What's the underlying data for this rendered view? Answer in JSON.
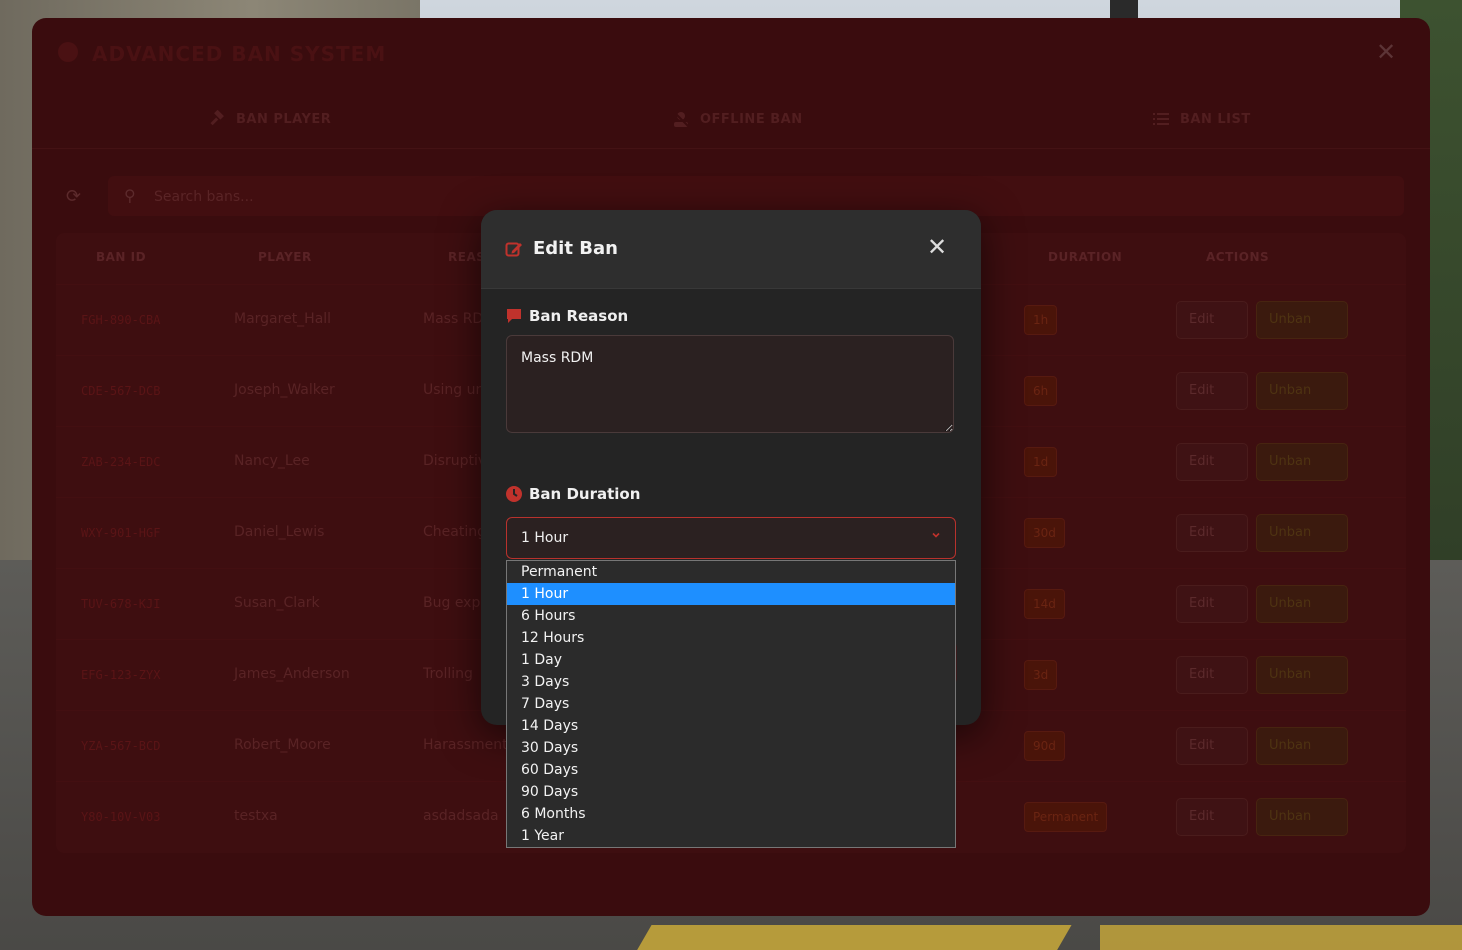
{
  "panel": {
    "title": "ADVANCED BAN SYSTEM",
    "tabs": [
      "BAN PLAYER",
      "OFFLINE BAN",
      "BAN LIST"
    ],
    "search_placeholder": "Search bans...",
    "columns": [
      "BAN ID",
      "PLAYER",
      "REASON",
      "DURATION",
      "ACTIONS"
    ],
    "rows": [
      {
        "id": "FGH-890-CBA",
        "player": "Margaret_Hall",
        "reason": "Mass RDM",
        "duration": "1h"
      },
      {
        "id": "CDE-567-DCB",
        "player": "Joseph_Walker",
        "reason": "Using unauthorized",
        "duration": "6h"
      },
      {
        "id": "ZAB-234-EDC",
        "player": "Nancy_Lee",
        "reason": "Disruptive",
        "duration": "1d"
      },
      {
        "id": "WXY-901-HGF",
        "player": "Daniel_Lewis",
        "reason": "Cheating",
        "duration": "30d"
      },
      {
        "id": "TUV-678-KJI",
        "player": "Susan_Clark",
        "reason": "Bug exploit",
        "duration": "14d"
      },
      {
        "id": "EFG-123-ZYX",
        "player": "James_Anderson",
        "reason": "Trolling",
        "duration": "3d"
      },
      {
        "id": "YZA-567-BCD",
        "player": "Robert_Moore",
        "reason": "Harassment",
        "duration": "90d"
      },
      {
        "id": "Y80-10V-V03",
        "player": "testxa",
        "reason": "asdadsada",
        "duration": "Permanent"
      }
    ],
    "edit_label": "Edit",
    "unban_label": "Unban"
  },
  "modal": {
    "title": "Edit Ban",
    "close": "✕",
    "reason_label": "Ban Reason",
    "reason_value": "Mass RDM",
    "duration_label": "Ban Duration",
    "duration_selected": "1 Hour"
  },
  "dropdown": {
    "options": [
      "Permanent",
      "1 Hour",
      "6 Hours",
      "12 Hours",
      "1 Day",
      "3 Days",
      "7 Days",
      "14 Days",
      "30 Days",
      "60 Days",
      "90 Days",
      "6 Months",
      "1 Year"
    ],
    "selected_index": 1
  },
  "colors": {
    "accent": "#b8322d",
    "highlight": "#1e8fff",
    "modal_bg": "#242424"
  }
}
